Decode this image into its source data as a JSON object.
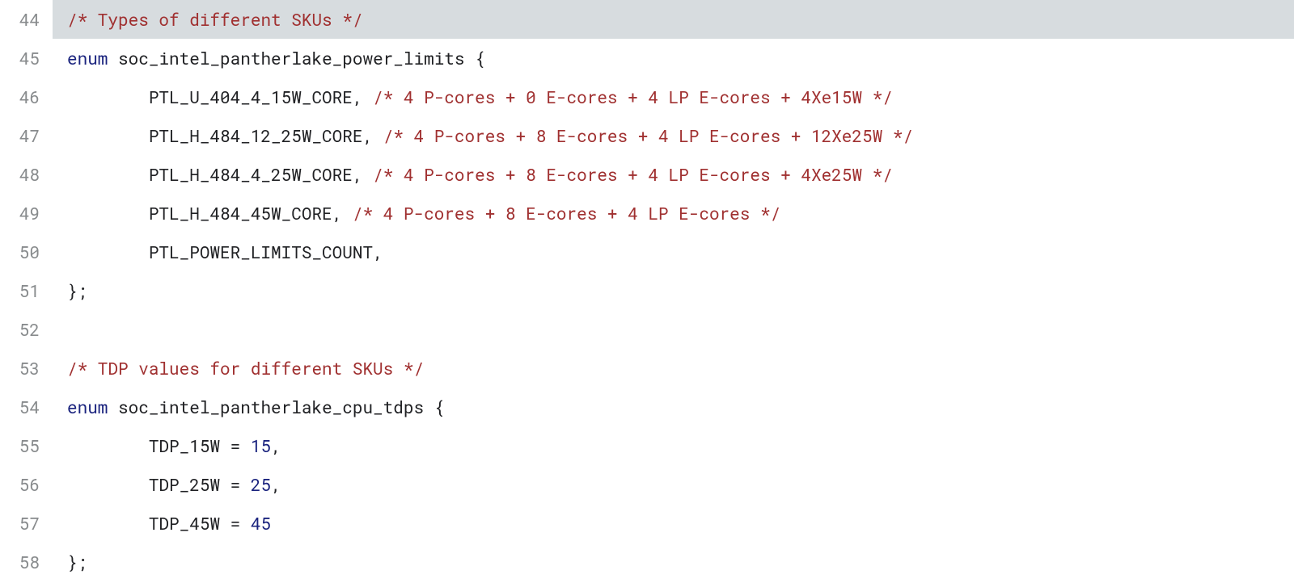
{
  "lines": [
    {
      "num": "44",
      "cls": "hilite",
      "tokens": [
        {
          "t": "/* Types of different SKUs */",
          "c": "tok-comment"
        }
      ]
    },
    {
      "num": "45",
      "cls": "",
      "tokens": [
        {
          "t": "enum",
          "c": "tok-keyword"
        },
        {
          "t": " ",
          "c": ""
        },
        {
          "t": "soc_intel_pantherlake_power_limits",
          "c": "tok-type"
        },
        {
          "t": " ",
          "c": ""
        },
        {
          "t": "{",
          "c": "tok-punct"
        }
      ]
    },
    {
      "num": "46",
      "cls": "",
      "indent": 1,
      "tokens": [
        {
          "t": "PTL_U_404_4_15W_CORE",
          "c": "tok-ident"
        },
        {
          "t": ",",
          "c": "tok-punct"
        },
        {
          "t": " ",
          "c": ""
        },
        {
          "t": "/* 4 P-cores + 0 E-cores + 4 LP E-cores + 4Xe15W */",
          "c": "tok-comment"
        }
      ]
    },
    {
      "num": "47",
      "cls": "",
      "indent": 1,
      "tokens": [
        {
          "t": "PTL_H_484_12_25W_CORE",
          "c": "tok-ident"
        },
        {
          "t": ",",
          "c": "tok-punct"
        },
        {
          "t": " ",
          "c": ""
        },
        {
          "t": "/* 4 P-cores + 8 E-cores + 4 LP E-cores + 12Xe25W */",
          "c": "tok-comment"
        }
      ]
    },
    {
      "num": "48",
      "cls": "",
      "indent": 1,
      "tokens": [
        {
          "t": "PTL_H_484_4_25W_CORE",
          "c": "tok-ident"
        },
        {
          "t": ",",
          "c": "tok-punct"
        },
        {
          "t": " ",
          "c": ""
        },
        {
          "t": "/* 4 P-cores + 8 E-cores + 4 LP E-cores + 4Xe25W */",
          "c": "tok-comment"
        }
      ]
    },
    {
      "num": "49",
      "cls": "",
      "indent": 1,
      "tokens": [
        {
          "t": "PTL_H_484_45W_CORE",
          "c": "tok-ident"
        },
        {
          "t": ",",
          "c": "tok-punct"
        },
        {
          "t": " ",
          "c": ""
        },
        {
          "t": "/* 4 P-cores + 8 E-cores + 4 LP E-cores */",
          "c": "tok-comment"
        }
      ]
    },
    {
      "num": "50",
      "cls": "",
      "indent": 1,
      "tokens": [
        {
          "t": "PTL_POWER_LIMITS_COUNT",
          "c": "tok-ident"
        },
        {
          "t": ",",
          "c": "tok-punct"
        }
      ]
    },
    {
      "num": "51",
      "cls": "",
      "tokens": [
        {
          "t": "};",
          "c": "tok-punct"
        }
      ]
    },
    {
      "num": "52",
      "cls": "",
      "tokens": [
        {
          "t": "",
          "c": ""
        }
      ]
    },
    {
      "num": "53",
      "cls": "",
      "tokens": [
        {
          "t": "/* TDP values for different SKUs */",
          "c": "tok-comment"
        }
      ]
    },
    {
      "num": "54",
      "cls": "",
      "tokens": [
        {
          "t": "enum",
          "c": "tok-keyword"
        },
        {
          "t": " ",
          "c": ""
        },
        {
          "t": "soc_intel_pantherlake_cpu_tdps",
          "c": "tok-type"
        },
        {
          "t": " ",
          "c": ""
        },
        {
          "t": "{",
          "c": "tok-punct"
        }
      ]
    },
    {
      "num": "55",
      "cls": "",
      "indent": 1,
      "tokens": [
        {
          "t": "TDP_15W",
          "c": "tok-ident"
        },
        {
          "t": " ",
          "c": ""
        },
        {
          "t": "=",
          "c": "tok-punct"
        },
        {
          "t": " ",
          "c": ""
        },
        {
          "t": "15",
          "c": "tok-num"
        },
        {
          "t": ",",
          "c": "tok-punct"
        }
      ]
    },
    {
      "num": "56",
      "cls": "",
      "indent": 1,
      "tokens": [
        {
          "t": "TDP_25W",
          "c": "tok-ident"
        },
        {
          "t": " ",
          "c": ""
        },
        {
          "t": "=",
          "c": "tok-punct"
        },
        {
          "t": " ",
          "c": ""
        },
        {
          "t": "25",
          "c": "tok-num"
        },
        {
          "t": ",",
          "c": "tok-punct"
        }
      ]
    },
    {
      "num": "57",
      "cls": "",
      "indent": 1,
      "tokens": [
        {
          "t": "TDP_45W",
          "c": "tok-ident"
        },
        {
          "t": " ",
          "c": ""
        },
        {
          "t": "=",
          "c": "tok-punct"
        },
        {
          "t": " ",
          "c": ""
        },
        {
          "t": "45",
          "c": "tok-num"
        }
      ]
    },
    {
      "num": "58",
      "cls": "",
      "tokens": [
        {
          "t": "};",
          "c": "tok-punct"
        }
      ]
    }
  ]
}
